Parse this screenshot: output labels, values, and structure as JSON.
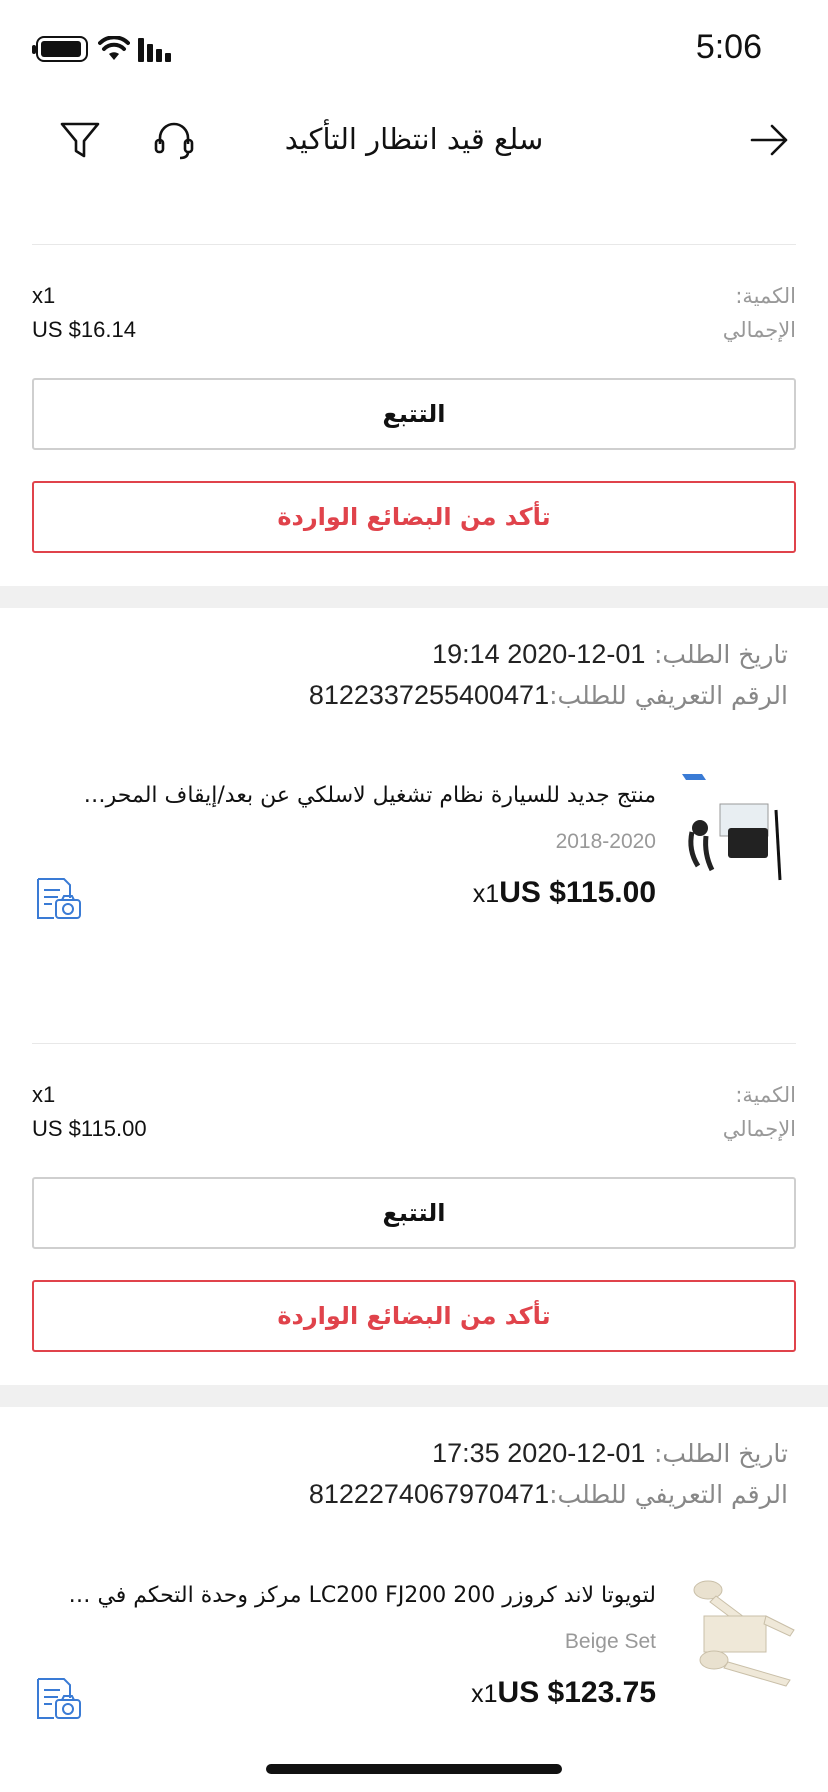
{
  "status_bar": {
    "time": "5:06"
  },
  "header": {
    "title": "سلع قيد انتظار التأكيد"
  },
  "labels": {
    "quantity": "الكمية:",
    "total": "الإجمالي",
    "order_date": "تاريخ الطلب:",
    "order_id": "الرقم التعريفي للطلب:",
    "track_button": "التتبع",
    "confirm_button": "تأكد من البضائع الواردة"
  },
  "first_summary": {
    "quantity": "x1",
    "total": "US $16.14"
  },
  "orders": [
    {
      "date": "01-12-2020 19:14",
      "id": "8122337255400471",
      "product": {
        "title": "منتج جديد للسيارة نظام تشغيل لاسلكي عن بعد/إيقاف المحرك لمرسيدس بنز",
        "variant": "2018-2020",
        "qty": "x1",
        "price": "US $115.00"
      },
      "summary": {
        "quantity": "x1",
        "total": "US $115.00"
      }
    },
    {
      "date": "01-12-2020 17:35",
      "id": "8122274067970471",
      "product": {
        "title": "لتويوتا لاند كروزر LC200 FJ200 200 مركز وحدة التحكم في الكأس",
        "variant": "Beige Set",
        "qty": "x1",
        "price": "US $123.75"
      }
    }
  ],
  "colors": {
    "accent": "#e0434b",
    "muted": "#999999",
    "separator": "#f0f0f0"
  }
}
